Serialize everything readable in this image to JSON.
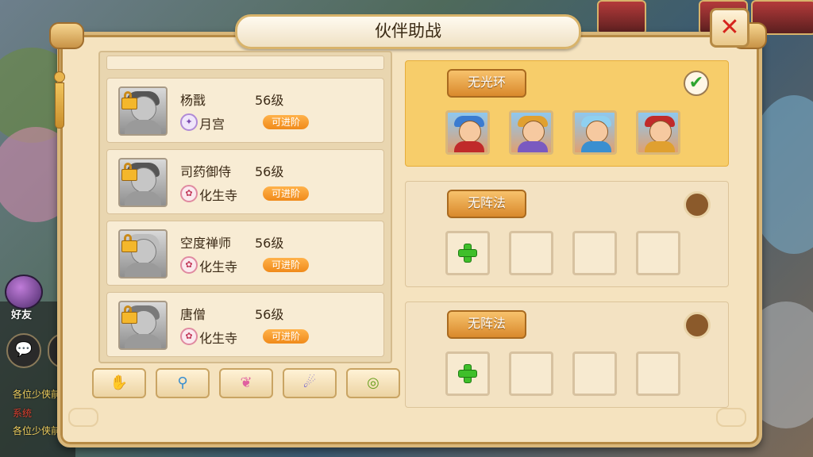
{
  "background": {
    "friend_label": "好友",
    "chat_lines": [
      {
        "text": "各位少侠前",
        "color": "#f0d060"
      },
      {
        "text": "系统",
        "color": "#e04030"
      },
      {
        "text": "各位少侠前",
        "color": "#f0d060"
      }
    ]
  },
  "panel": {
    "title": "伙伴助战",
    "close_symbol": "✕"
  },
  "partners": [
    {
      "name": "杨戬",
      "level": "56级",
      "sect": "月宫",
      "sect_icon": "moon-palace-icon",
      "action": "可进阶",
      "locked": true
    },
    {
      "name": "司药御侍",
      "level": "56级",
      "sect": "化生寺",
      "sect_icon": "huasheng-temple-icon",
      "action": "可进阶",
      "locked": true
    },
    {
      "name": "空度禅师",
      "level": "56级",
      "sect": "化生寺",
      "sect_icon": "huasheng-temple-icon",
      "action": "可进阶",
      "locked": true
    },
    {
      "name": "唐僧",
      "level": "56级",
      "sect": "化生寺",
      "sect_icon": "huasheng-temple-icon",
      "action": "可进阶",
      "locked": true
    }
  ],
  "filters": [
    {
      "icon": "attack-icon",
      "glyph": "✋",
      "color": "#e0a020"
    },
    {
      "icon": "magic-icon",
      "glyph": "⚲",
      "color": "#3a8fd0"
    },
    {
      "icon": "heal-icon",
      "glyph": "❦",
      "color": "#e060a0"
    },
    {
      "icon": "seal-icon",
      "glyph": "☄",
      "color": "#6a5ad0"
    },
    {
      "icon": "support-icon",
      "glyph": "◎",
      "color": "#6aa020"
    }
  ],
  "groups": [
    {
      "label": "无光环",
      "active": true,
      "checked": true,
      "slots": [
        {
          "type": "hero",
          "hero": "pigsy-icon",
          "hat": "#3a7bd0",
          "body": "#c02a2a"
        },
        {
          "type": "hero",
          "hero": "warrior-icon",
          "hat": "#e0a030",
          "body": "#7a5ac0"
        },
        {
          "type": "hero",
          "hero": "mage-icon",
          "hat": "#8fd0f0",
          "body": "#3a8fd0"
        },
        {
          "type": "hero",
          "hero": "monkey-icon",
          "hat": "#c02a2a",
          "body": "#e0a030"
        }
      ]
    },
    {
      "label": "无阵法",
      "active": false,
      "checked": false,
      "slots": [
        {
          "type": "add"
        },
        {
          "type": "empty"
        },
        {
          "type": "empty"
        },
        {
          "type": "empty"
        }
      ]
    },
    {
      "label": "无阵法",
      "active": false,
      "checked": false,
      "slots": [
        {
          "type": "add"
        },
        {
          "type": "empty"
        },
        {
          "type": "empty"
        },
        {
          "type": "empty"
        }
      ]
    }
  ]
}
